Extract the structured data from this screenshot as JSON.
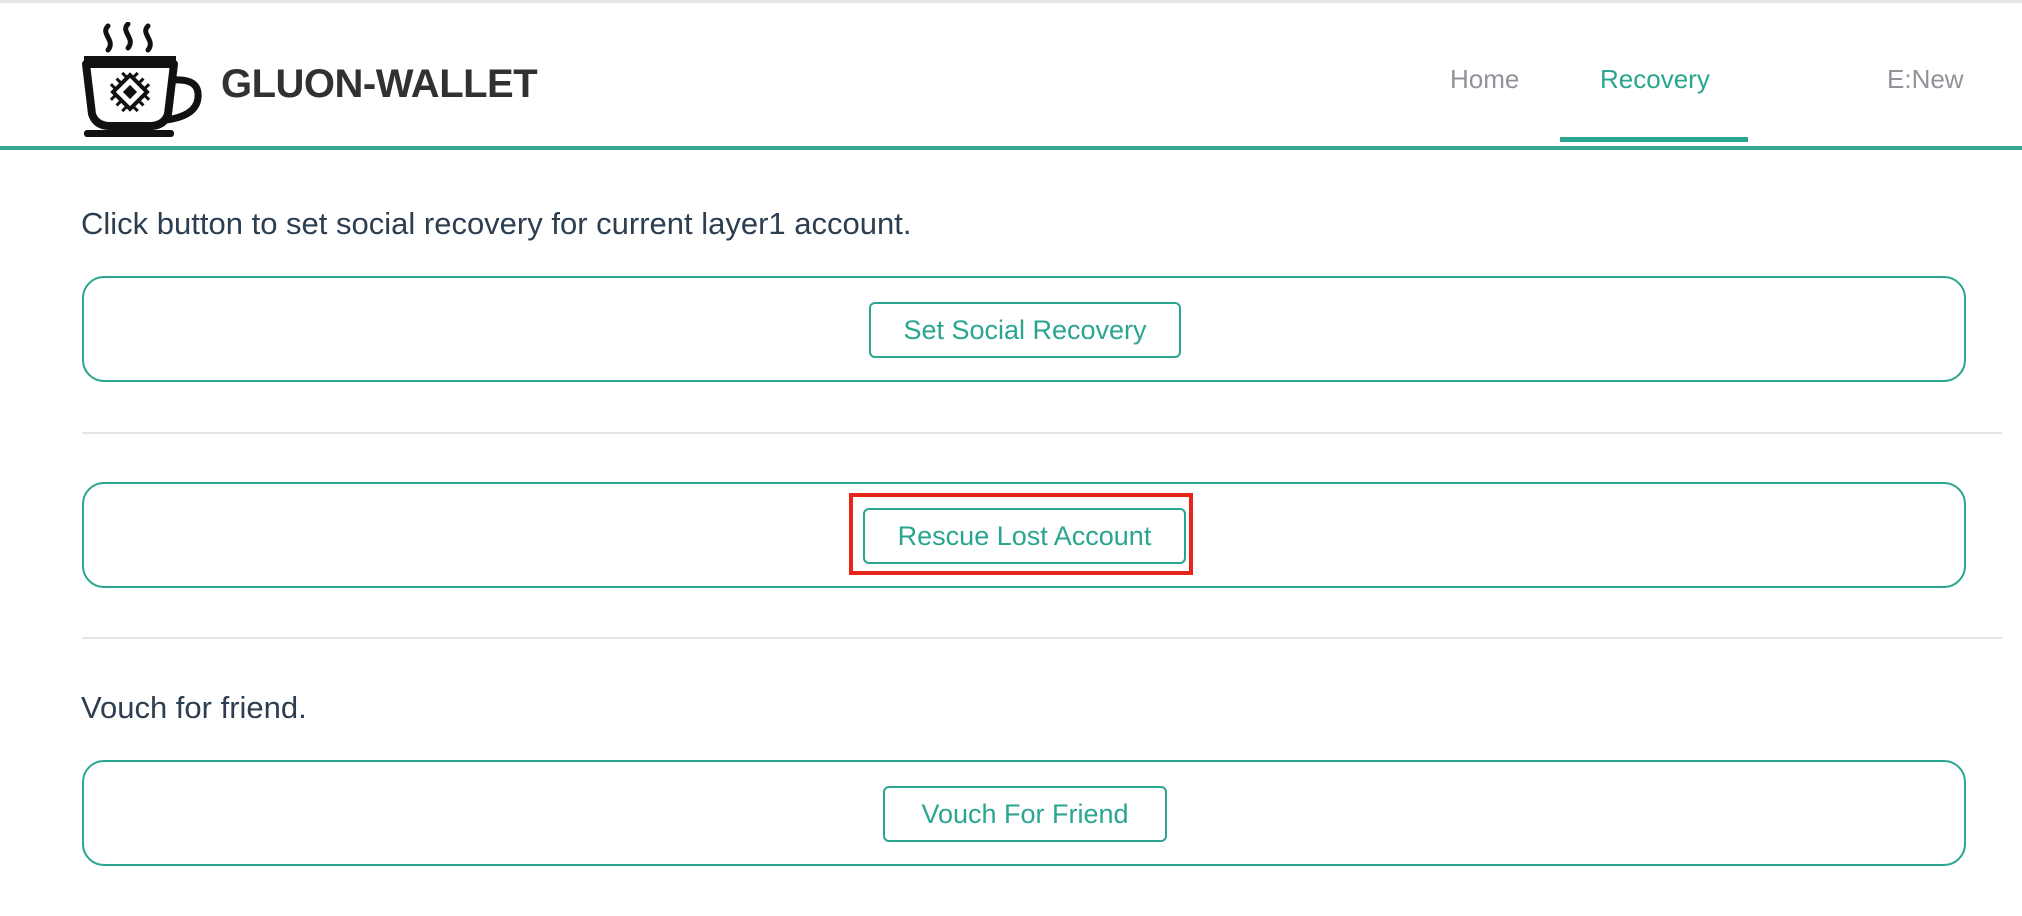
{
  "header": {
    "brand": "GLUON-WALLET",
    "logo_icon": "coffee-cup-chip-icon",
    "nav": {
      "home": "Home",
      "recovery": "Recovery",
      "account": "E:New"
    },
    "active_tab": "Recovery"
  },
  "main": {
    "social_recovery_text": "Click button to set social recovery for current layer1 account.",
    "set_social_recovery_label": "Set Social Recovery",
    "rescue_lost_account_label": "Rescue Lost Account",
    "vouch_text": "Vouch for friend.",
    "vouch_for_friend_label": "Vouch For Friend"
  },
  "colors": {
    "accent": "#2aa58f",
    "text": "#2c3e50",
    "muted": "#909399",
    "highlight": "#e8251b"
  }
}
